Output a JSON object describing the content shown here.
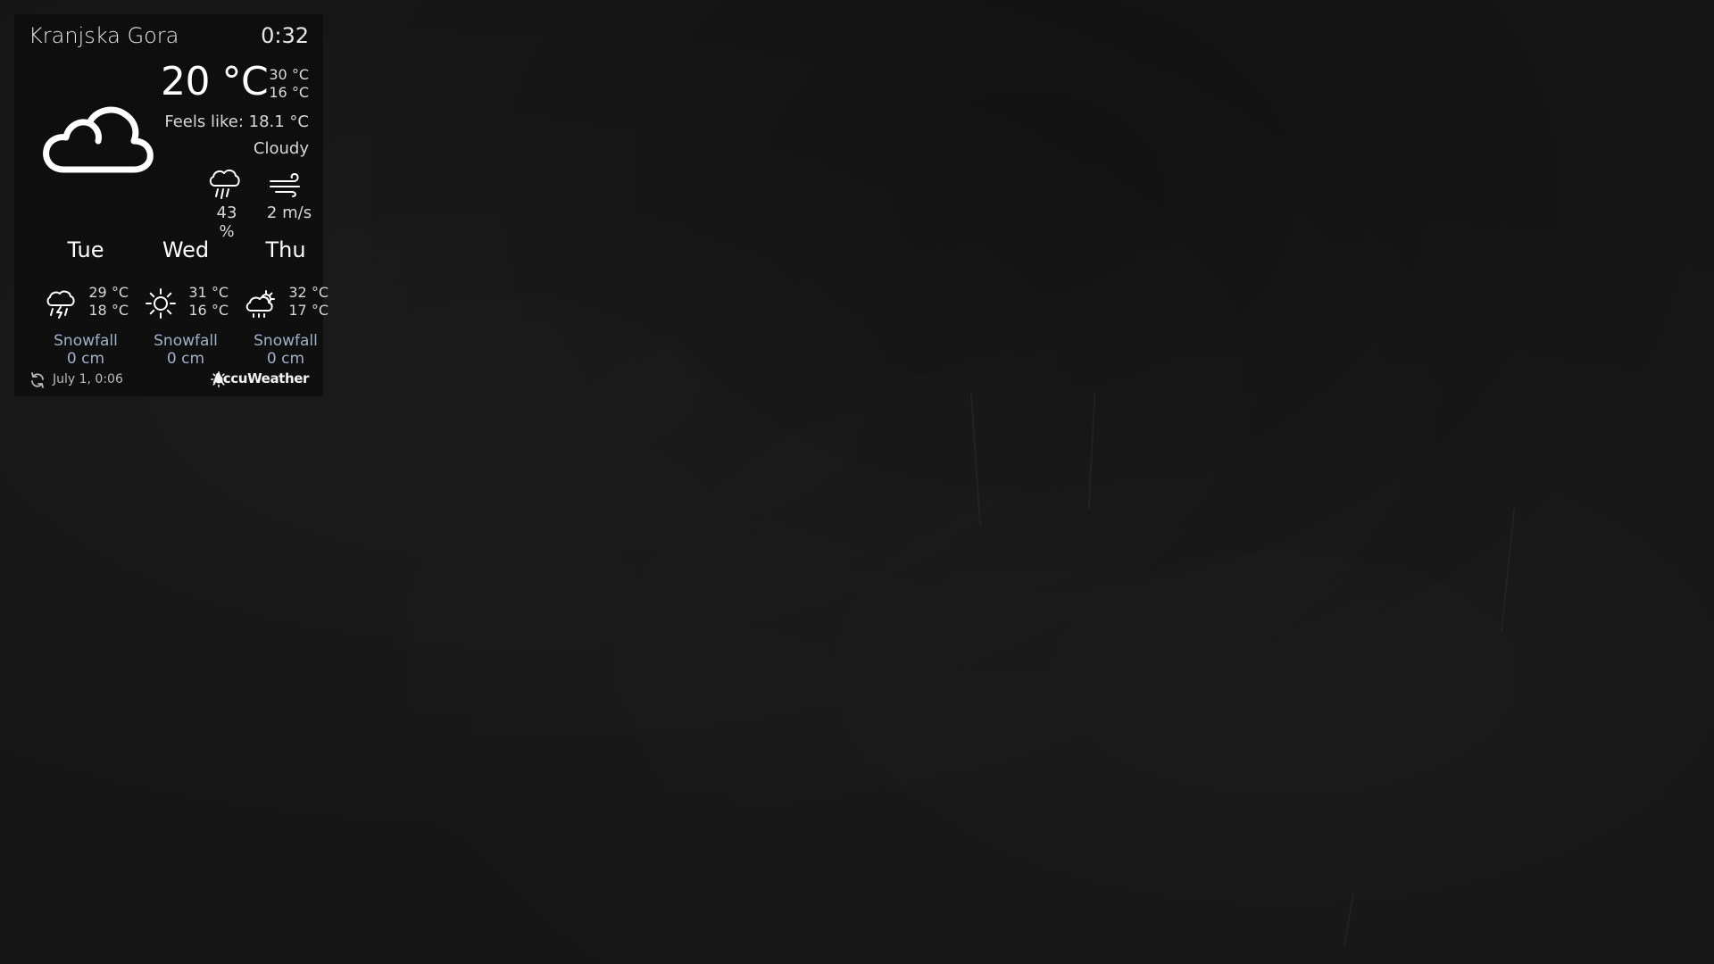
{
  "location": {
    "city": "Kranjska Gora",
    "time": "0:32"
  },
  "current": {
    "temperature": "20 °C",
    "temp_high": "30 °C",
    "temp_low": "16 °C",
    "feels_like": "Feels like: 18.1 °C",
    "condition": "Cloudy",
    "icon": "cloud-icon",
    "precipitation": "43 %",
    "precipitation_icon": "rain-cloud-icon",
    "wind": "2 m/s",
    "wind_icon": "wind-icon"
  },
  "forecast": [
    {
      "day": "Tue",
      "high": "29 °C",
      "low": "18 °C",
      "icon": "thunderstorm-icon",
      "snow_label": "Snowfall",
      "snow_value": "0 cm"
    },
    {
      "day": "Wed",
      "high": "31 °C",
      "low": "16 °C",
      "icon": "sun-icon",
      "snow_label": "Snowfall",
      "snow_value": "0 cm"
    },
    {
      "day": "Thu",
      "high": "32 °C",
      "low": "17 °C",
      "icon": "partly-cloudy-icon",
      "snow_label": "Snowfall",
      "snow_value": "0 cm"
    }
  ],
  "footer": {
    "updated": "July  1, 0:06",
    "refresh_icon": "refresh-icon",
    "brand": "AccuWeather",
    "brand_icon": "accuweather-sun-icon"
  },
  "colors": {
    "background": "#161616",
    "widget_background": "#080808",
    "text": "#ffffff",
    "snowfall_text": "#9fb2c8"
  }
}
